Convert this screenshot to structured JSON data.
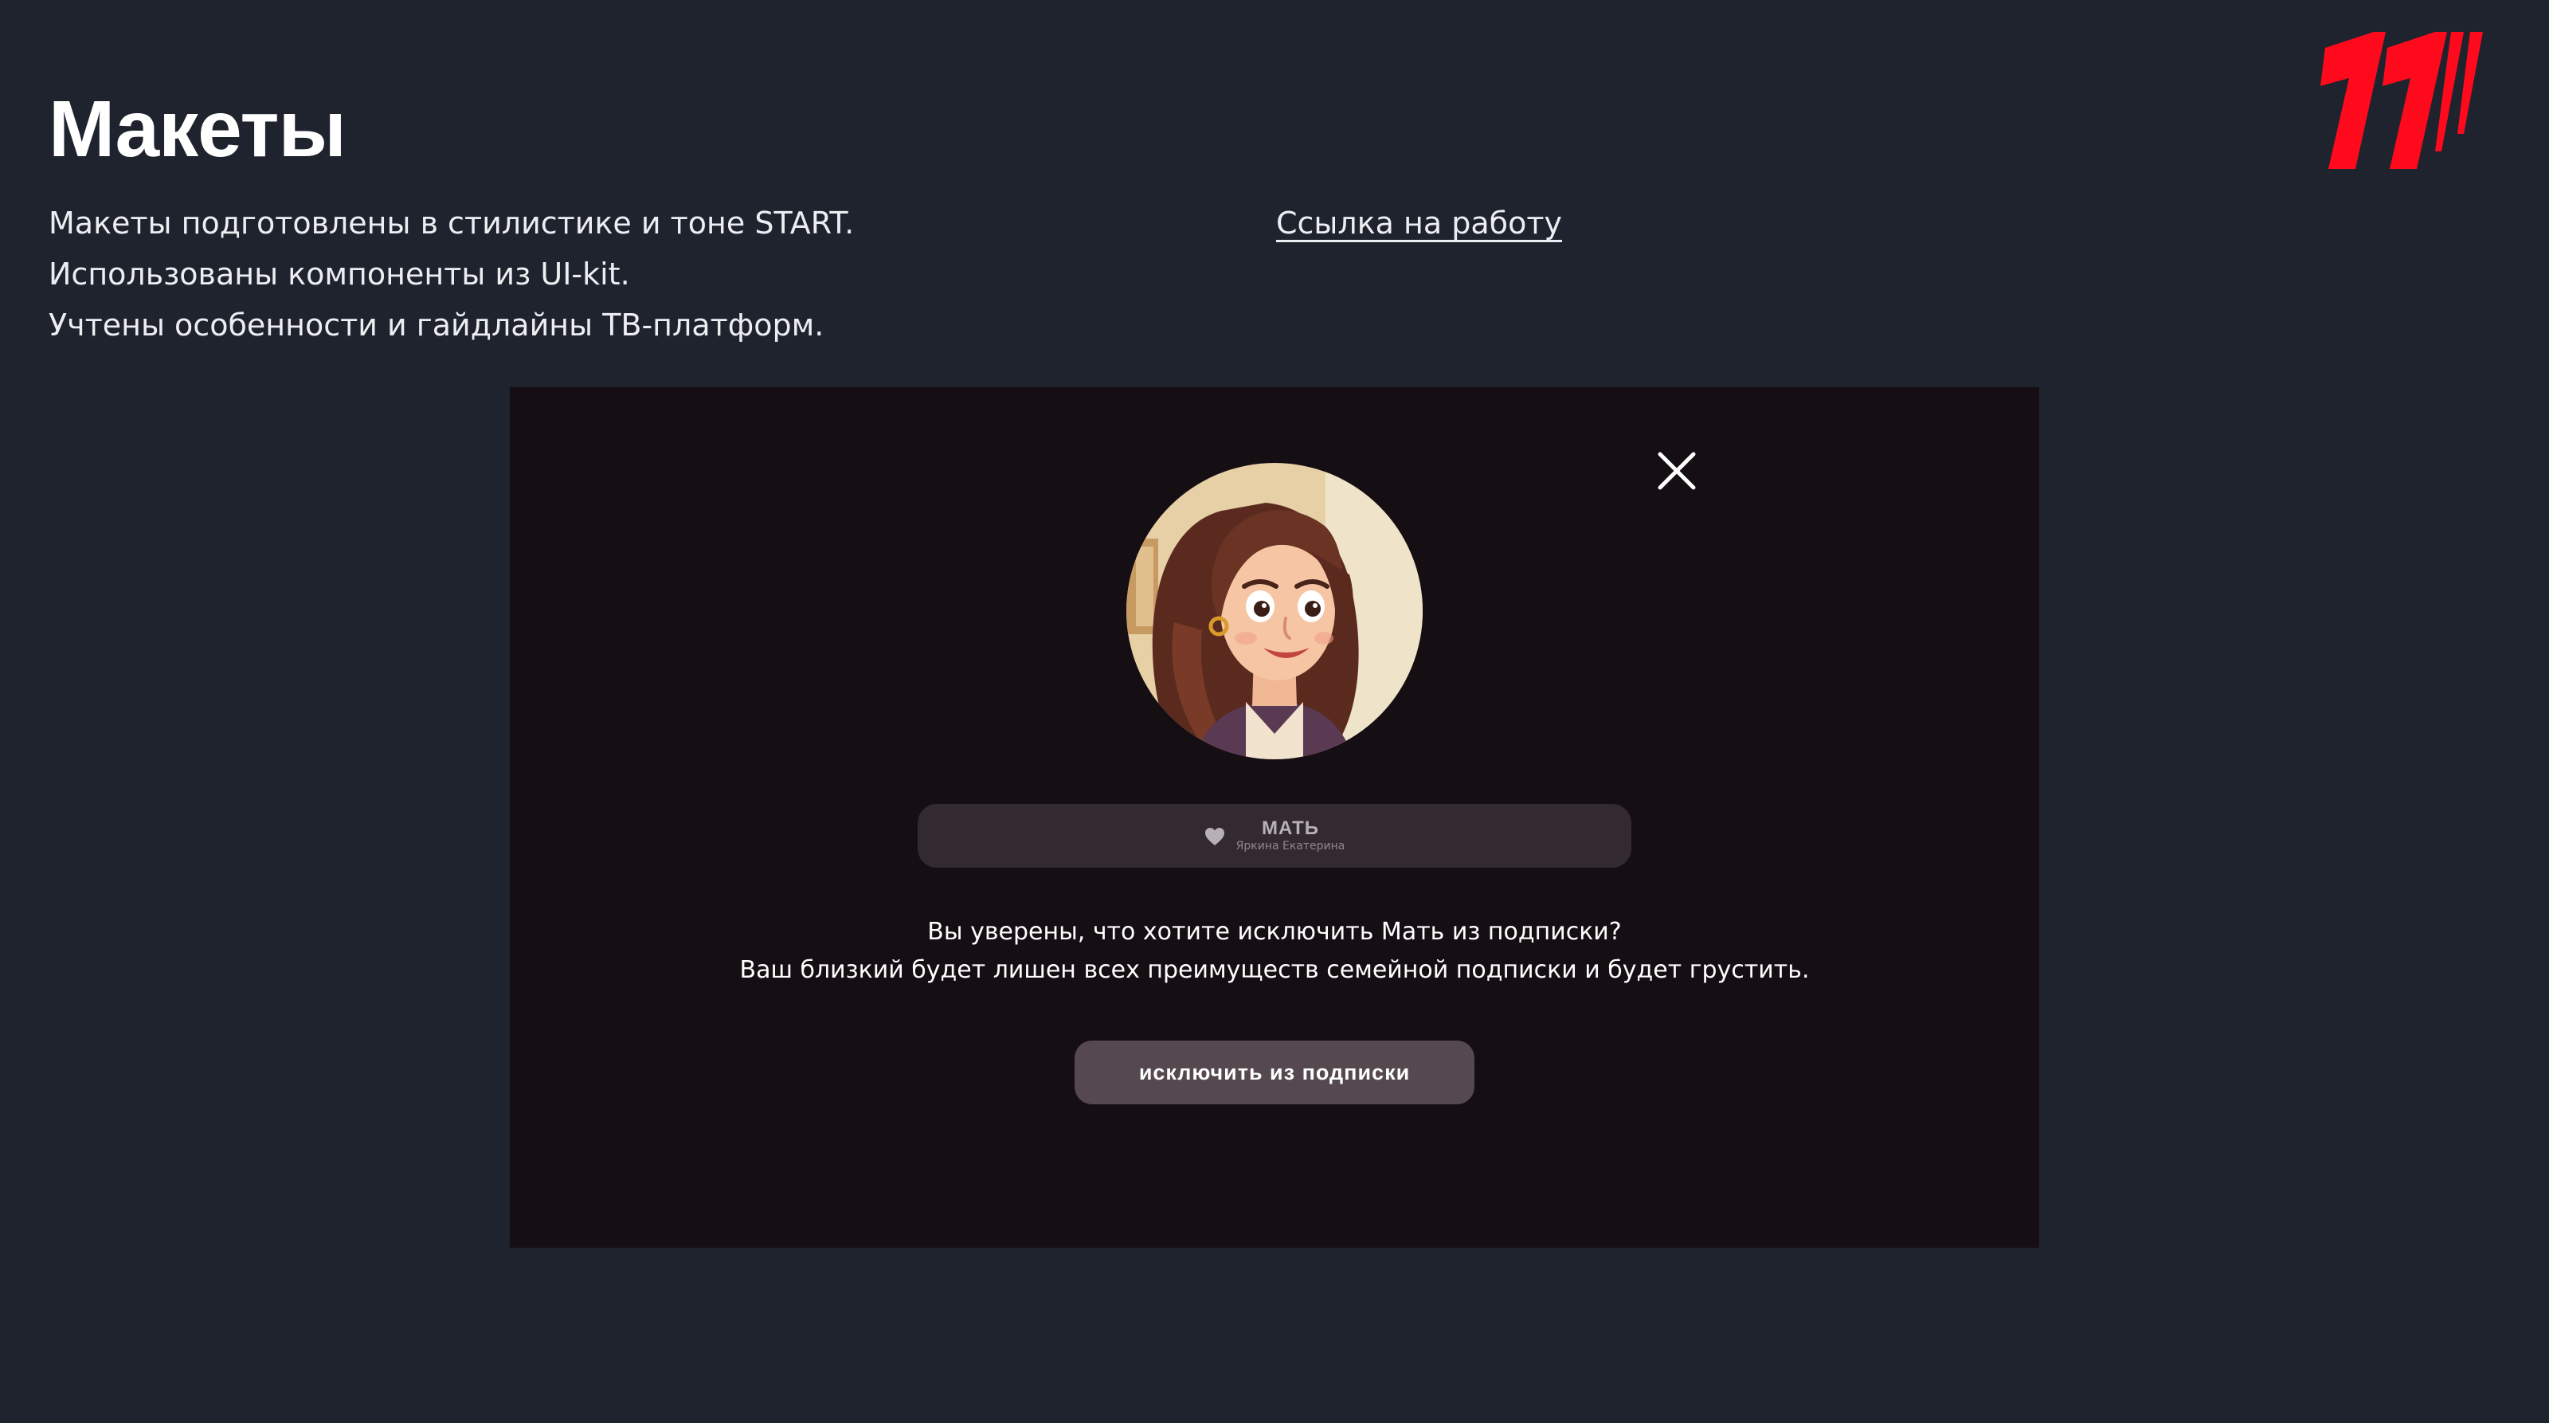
{
  "slide": {
    "title": "Макеты",
    "description": [
      "Макеты подготовлены в стилистике и тоне START.",
      "Использованы компоненты из UI-kit.",
      "Учтены особенности и гайдлайны ТВ-платформ."
    ],
    "link_label": "Ссылка на работу"
  },
  "dialog": {
    "member": {
      "role": "МАТЬ",
      "name": "Яркина Екатерина",
      "icon": "heart-icon"
    },
    "message": [
      "Вы уверены, что хотите исключить Мать из подписки?",
      "Ваш близкий будет лишен всех преимуществ семейной подписки и будет грустить."
    ],
    "button_label": "исключить из подписки",
    "close_icon": "close-icon"
  },
  "colors": {
    "page_background": "#1f232e",
    "screen_background": "#150e13",
    "member_bar": "#332a31",
    "button_background": "#55494f",
    "logo_red": "#ff0a1c"
  }
}
